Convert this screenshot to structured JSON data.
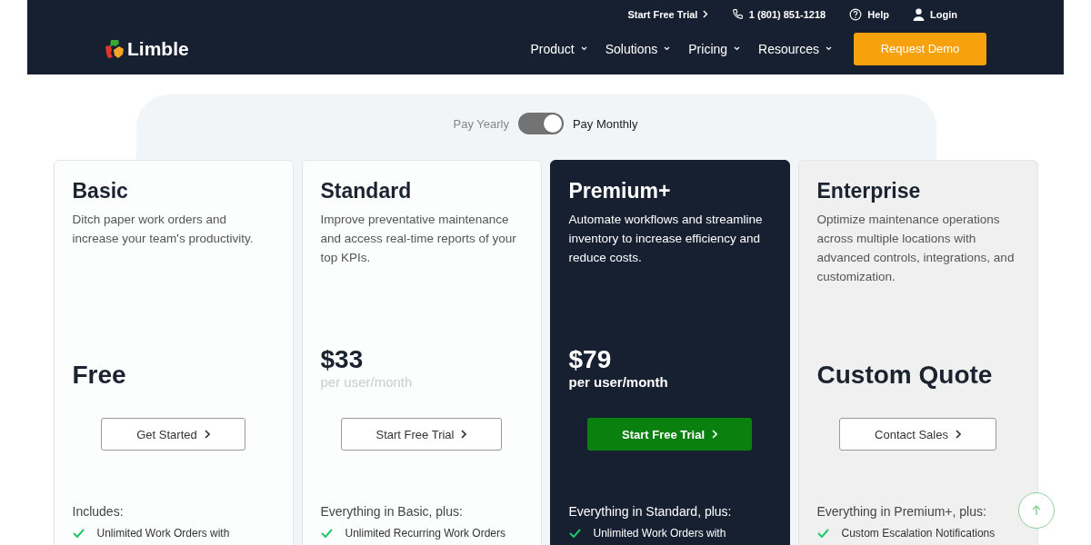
{
  "top_bar": {
    "trial_link": "Start Free Trial",
    "phone": "1 (801) 851-1218",
    "help": "Help",
    "login": "Login"
  },
  "header": {
    "logo": "Limble",
    "nav": [
      {
        "label": "Product"
      },
      {
        "label": "Solutions"
      },
      {
        "label": "Pricing"
      },
      {
        "label": "Resources"
      }
    ],
    "cta": "Request Demo"
  },
  "billing": {
    "yearly_label": "Pay Yearly",
    "monthly_label": "Pay Monthly",
    "monthly": true
  },
  "plans": [
    {
      "kind": "light",
      "name": "Basic",
      "description": "Ditch paper work orders and increase your team's productivity.",
      "price": "Free",
      "button": {
        "label": "Get Started",
        "kind": "outline"
      },
      "includes": "Includes:",
      "features": [
        "Unlimited Work Orders with"
      ]
    },
    {
      "kind": "light",
      "name": "Standard",
      "description": "Improve preventative maintenance and access real-time reports of your top KPIs.",
      "price": "$33",
      "price_note": "per user/month",
      "price_note_muted": true,
      "button": {
        "label": "Start Free Trial",
        "kind": "outline"
      },
      "includes": "Everything in Basic, plus:",
      "features": [
        "Unlimited Recurring Work Orders"
      ]
    },
    {
      "kind": "dark",
      "name": "Premium+",
      "description": "Automate workflows and streamline inventory to increase efficiency and reduce costs.",
      "price": "$79",
      "price_note": "per user/month",
      "price_note_muted": false,
      "button": {
        "label": "Start Free Trial",
        "kind": "primary"
      },
      "includes": "Everything in Standard, plus:",
      "features": [
        "Unlimited Work Orders with"
      ]
    },
    {
      "kind": "grey",
      "name": "Enterprise",
      "description": "Optimize maintenance operations across multiple locations with advanced controls, integrations, and customization.",
      "price": "Custom Quote",
      "button": {
        "label": "Contact Sales",
        "kind": "outline"
      },
      "includes": "Everything in Premium+, plus:",
      "features": [
        "Custom Escalation Notifications"
      ]
    }
  ]
}
